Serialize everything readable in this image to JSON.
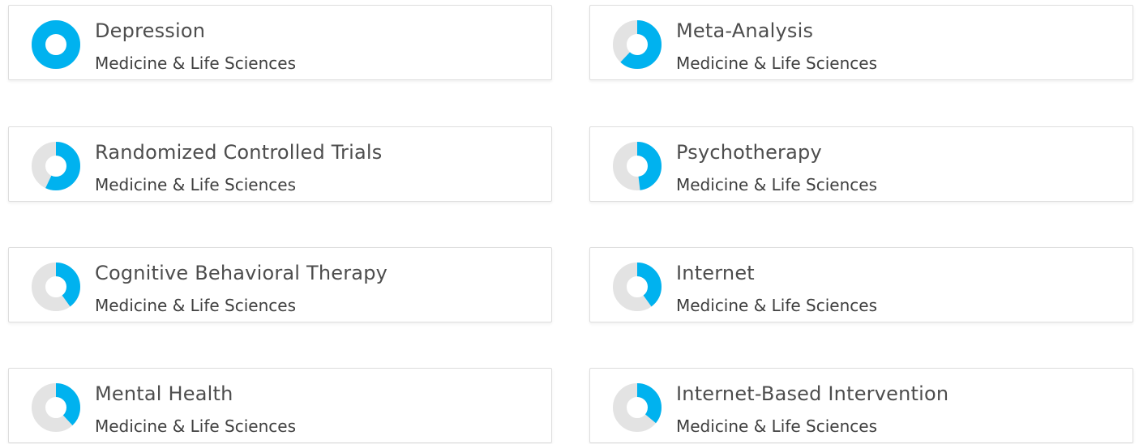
{
  "colors": {
    "accent": "#00b2ef",
    "track": "#e3e3e3"
  },
  "fingerprint": [
    {
      "title": "Depression",
      "subtitle": "Medicine & Life Sciences",
      "weight": 1.0
    },
    {
      "title": "Meta-Analysis",
      "subtitle": "Medicine & Life Sciences",
      "weight": 0.62
    },
    {
      "title": "Randomized Controlled Trials",
      "subtitle": "Medicine & Life Sciences",
      "weight": 0.57
    },
    {
      "title": "Psychotherapy",
      "subtitle": "Medicine & Life Sciences",
      "weight": 0.48
    },
    {
      "title": "Cognitive Behavioral Therapy",
      "subtitle": "Medicine & Life Sciences",
      "weight": 0.4
    },
    {
      "title": "Internet",
      "subtitle": "Medicine & Life Sciences",
      "weight": 0.4
    },
    {
      "title": "Mental Health",
      "subtitle": "Medicine & Life Sciences",
      "weight": 0.38
    },
    {
      "title": "Internet-Based Intervention",
      "subtitle": "Medicine & Life Sciences",
      "weight": 0.36
    }
  ]
}
